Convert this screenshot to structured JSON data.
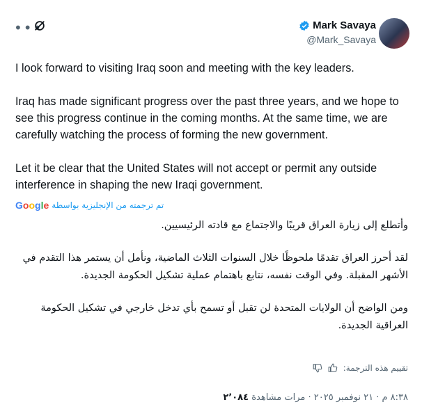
{
  "header": {
    "name": "Mark Savaya",
    "handle": "@Mark_Savaya",
    "more_icon": "more-horizontal-icon",
    "grok_icon": "grok-icon",
    "verified_icon": "verified-badge-icon"
  },
  "tweet": {
    "p1": "I look forward to visiting Iraq soon and meeting with the key leaders.",
    "p2": "Iraq has made significant progress over the past three years, and we hope to see this progress continue in the coming months. At the same time, we are carefully watching the process of forming the new government.",
    "p3": "Let it be clear that the United States will not accept or permit any outside interference in shaping the new Iraqi government."
  },
  "translation": {
    "label": "تم ترجمته من الإنجليزية بواسطة",
    "provider": "Google",
    "p1": "وأتطلع إلى زيارة العراق قريبًا والاجتماع مع قادته الرئيسيين.",
    "p2": "لقد أحرز العراق تقدمًا ملحوظًا خلال السنوات الثلاث الماضية، ونأمل أن يستمر هذا التقدم في الأشهر المقبلة. وفي الوقت نفسه، نتابع باهتمام عملية تشكيل الحكومة الجديدة.",
    "p3": "ومن الواضح أن الولايات المتحدة لن تقبل أو تسمح بأي تدخل خارجي في تشكيل الحكومة العراقية الجديدة.",
    "rate_label": "تقييم هذه الترجمة:"
  },
  "meta": {
    "timestamp": "٨:٣٨ م · ٢١ نوفمبر ٢٠٢٥ ·",
    "views_label": "مرات مشاهدة",
    "views": "٢٬٠٨٤"
  },
  "colors": {
    "accent": "#1d9bf0",
    "text": "#0f1419",
    "muted": "#536471"
  }
}
